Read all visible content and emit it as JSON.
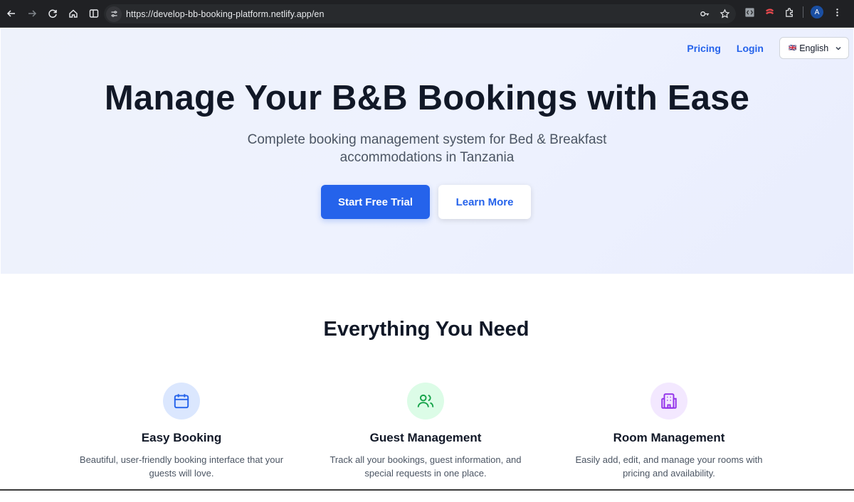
{
  "browser": {
    "url": "https://develop-bb-booking-platform.netlify.app/en",
    "profile_initial": "A"
  },
  "nav": {
    "pricing": "Pricing",
    "login": "Login",
    "language": "English",
    "language_flag": "🇬🇧"
  },
  "hero": {
    "title": "Manage Your B&B Bookings with Ease",
    "subtitle": "Complete booking management system for Bed & Breakfast accommodations in Tanzania",
    "primary_cta": "Start Free Trial",
    "secondary_cta": "Learn More"
  },
  "features": {
    "title": "Everything You Need",
    "items": [
      {
        "icon": "calendar-icon",
        "title": "Easy Booking",
        "description": "Beautiful, user-friendly booking interface that your guests will love."
      },
      {
        "icon": "users-icon",
        "title": "Guest Management",
        "description": "Track all your bookings, guest information, and special requests in one place."
      },
      {
        "icon": "building-icon",
        "title": "Room Management",
        "description": "Easily add, edit, and manage your rooms with pricing and availability."
      }
    ]
  },
  "colors": {
    "accent": "#2563eb",
    "heading": "#111827",
    "body_text": "#4b5563",
    "hero_bg": "#eef2fb"
  }
}
